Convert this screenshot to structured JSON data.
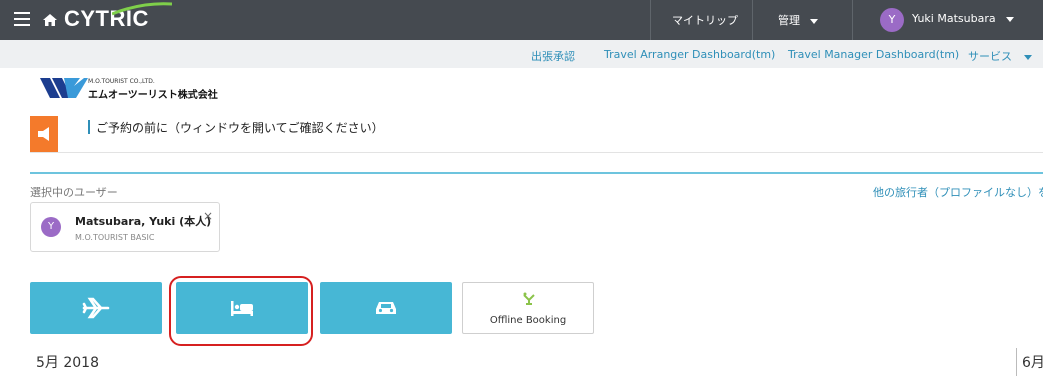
{
  "header": {
    "logo_text": "CYTRIC",
    "my_trips": "マイトリップ",
    "admin": "管理",
    "user_initial": "Y",
    "user_name": "Yuki Matsubara"
  },
  "subnav": {
    "items": [
      "出張承認",
      "Travel Arranger Dashboard(tm)",
      "Travel Manager Dashboard(tm)",
      "サービス"
    ]
  },
  "company": {
    "name_en": "M.O.TOURIST CO.,LTD.",
    "name_jp": "エムオーツーリスト株式会社"
  },
  "notice": {
    "text": "ご予約の前に（ウィンドウを開いてご確認ください）"
  },
  "traveler": {
    "section_label": "選択中のユーザー",
    "add_link": "他の旅行者（プロファイルなし）を追加",
    "initial": "Y",
    "name": "Matsubara, Yuki (本人)",
    "profile": "M.O.TOURIST BASIC",
    "close": "×"
  },
  "booking": {
    "modes": [
      "flight",
      "hotel",
      "car"
    ],
    "selected": "hotel",
    "offline_label": "Offline Booking"
  },
  "calendar": {
    "month_left": "5月 2018",
    "month_right": "6月"
  },
  "colors": {
    "topbar": "#454a50",
    "accent": "#47b7d5",
    "link": "#2f8fb8",
    "notice_icon": "#f47a2b",
    "avatar": "#9b6bc6",
    "highlight": "#d62020"
  }
}
